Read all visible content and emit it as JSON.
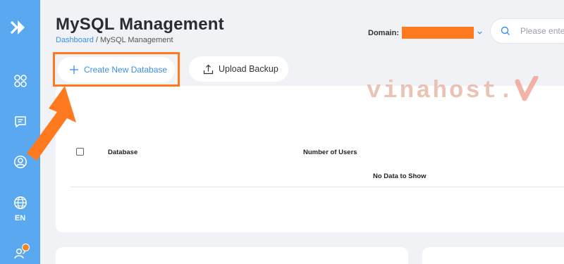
{
  "header": {
    "title": "MySQL Management",
    "breadcrumb": {
      "home": "Dashboard",
      "separator": " / ",
      "current": "MySQL Management"
    },
    "domain_label": "Domain:",
    "domain_value": "",
    "search_placeholder": "Please enter"
  },
  "sidebar": {
    "language_label": "EN",
    "icons": [
      "logo-icon",
      "apps-grid-icon",
      "message-icon",
      "user-icon",
      "globe-icon",
      "users-icon"
    ]
  },
  "toolbar": {
    "create_label": "Create New Database",
    "upload_label": "Upload Backup"
  },
  "table": {
    "columns": [
      "Database",
      "Number of Users"
    ],
    "empty_text": "No Data to Show"
  },
  "watermark": {
    "text": "vinahost."
  },
  "colors": {
    "sidebar": "#5aa9f0",
    "accent": "#3b8fe6",
    "highlight": "#ff7a1f",
    "watermark": "#e8b9a8",
    "background": "#f1f2f6"
  }
}
